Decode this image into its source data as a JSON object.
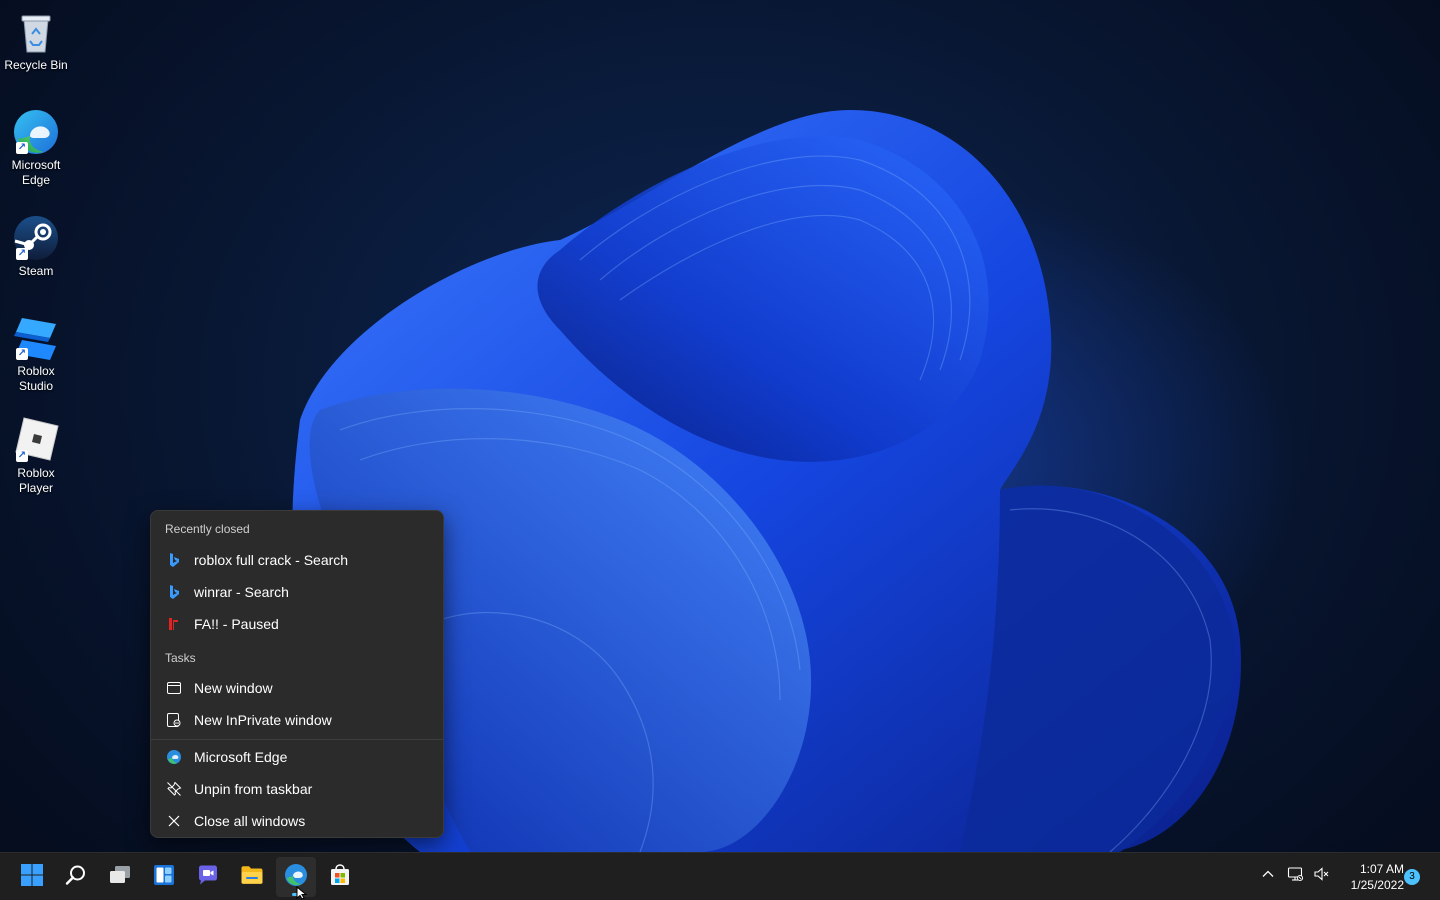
{
  "desktop": {
    "icons": [
      {
        "label": "Recycle Bin",
        "icon": "recycle-bin-icon",
        "shortcut": false
      },
      {
        "label": "Microsoft Edge",
        "icon": "edge-icon",
        "shortcut": true
      },
      {
        "label": "Steam",
        "icon": "steam-icon",
        "shortcut": true
      },
      {
        "label": "Roblox Studio",
        "icon": "roblox-studio-icon",
        "shortcut": true
      },
      {
        "label": "Roblox Player",
        "icon": "roblox-player-icon",
        "shortcut": true
      }
    ]
  },
  "jumplist": {
    "recently_closed_header": "Recently closed",
    "recent": [
      {
        "label": "roblox full crack - Search",
        "icon": "bing-icon"
      },
      {
        "label": "winrar - Search",
        "icon": "bing-icon"
      },
      {
        "label": "FA!! - Paused",
        "icon": "fa-tab-icon"
      }
    ],
    "tasks_header": "Tasks",
    "tasks": [
      {
        "label": "New window",
        "icon": "window-icon"
      },
      {
        "label": "New InPrivate window",
        "icon": "inprivate-window-icon"
      }
    ],
    "app_actions": [
      {
        "label": "Microsoft Edge",
        "icon": "edge-icon"
      },
      {
        "label": "Unpin from taskbar",
        "icon": "unpin-icon"
      },
      {
        "label": "Close all windows",
        "icon": "close-icon"
      }
    ]
  },
  "taskbar": {
    "apps": [
      {
        "name": "start",
        "icon": "windows-start-icon"
      },
      {
        "name": "search",
        "icon": "search-icon"
      },
      {
        "name": "task-view",
        "icon": "task-view-icon"
      },
      {
        "name": "widgets",
        "icon": "widgets-icon"
      },
      {
        "name": "chat",
        "icon": "teams-chat-icon"
      },
      {
        "name": "file-explorer",
        "icon": "folder-icon"
      },
      {
        "name": "edge",
        "icon": "edge-icon",
        "active": true
      },
      {
        "name": "store",
        "icon": "store-icon"
      }
    ],
    "tray": {
      "time": "1:07 AM",
      "date": "1/25/2022",
      "notification_count": "3"
    }
  },
  "colors": {
    "accent": "#4cc2ff",
    "menu_bg": "#2b2b2b",
    "taskbar_bg": "#1f1f1f"
  }
}
